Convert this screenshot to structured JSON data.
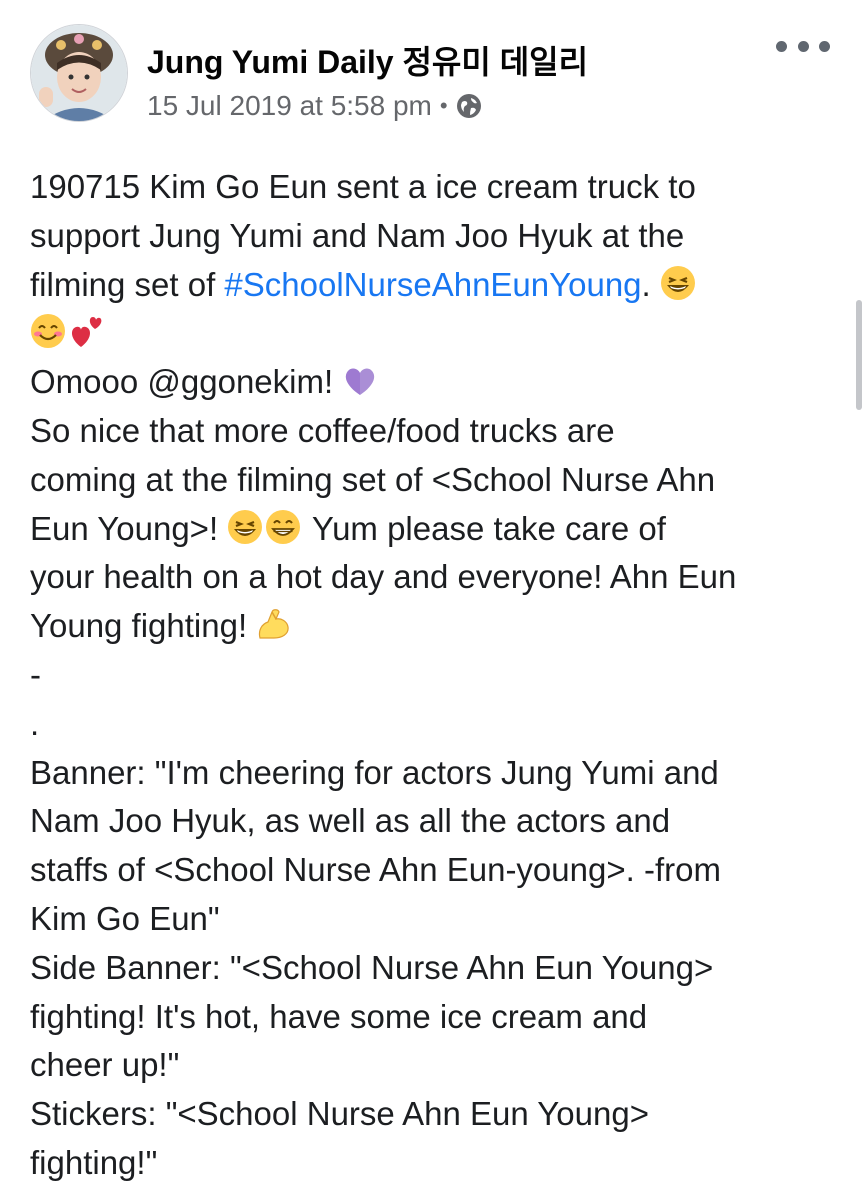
{
  "post": {
    "page_name": "Jung Yumi Daily 정유미 데일리",
    "timestamp": "15 Jul 2019 at 5:58 pm",
    "separator": "•",
    "privacy_icon": "globe-icon",
    "more_icon": "more-options-icon",
    "text": {
      "l1": "190715 Kim Go Eun sent a ice cream truck to",
      "l2": "support Jung Yumi and Nam Joo Hyuk at the",
      "l3_pre": "filming set of ",
      "hashtag": "#SchoolNurseAhnEunYoung",
      "l3_post": ".",
      "l5": "Omooo @ggonekim!",
      "l6": "So nice that more coffee/food trucks are",
      "l7": "coming at the filming set of <School Nurse Ahn",
      "l8_pre": "Eun Young>!",
      "l8_post": "Yum please take care of",
      "l9": "your health on a hot day and everyone! Ahn Eun",
      "l10": "Young fighting!",
      "l11": "-",
      "l12": ".",
      "l13": "Banner: \"I'm cheering for actors Jung Yumi and",
      "l14": "Nam Joo Hyuk, as well as all the actors and",
      "l15": "staffs of <School Nurse Ahn Eun-young>. -from",
      "l16": "Kim Go Eun\"",
      "l17": "Side Banner: \"<School Nurse Ahn Eun Young>",
      "l18": "fighting! It's hot, have some ice cream and",
      "l19": "cheer up!\"",
      "l20": "Stickers: \"<School Nurse Ahn Eun Young>",
      "l21": "fighting!\""
    },
    "emojis": [
      "grinning-squinting-emoji",
      "smiling-blush-emoji",
      "two-hearts-emoji",
      "purple-heart-emoji",
      "grinning-squinting-emoji",
      "beaming-grin-emoji",
      "flexed-biceps-emoji"
    ]
  },
  "colors": {
    "hashtag": "#1877f2",
    "meta_text": "#65676b",
    "body_text": "#1c1e21"
  }
}
